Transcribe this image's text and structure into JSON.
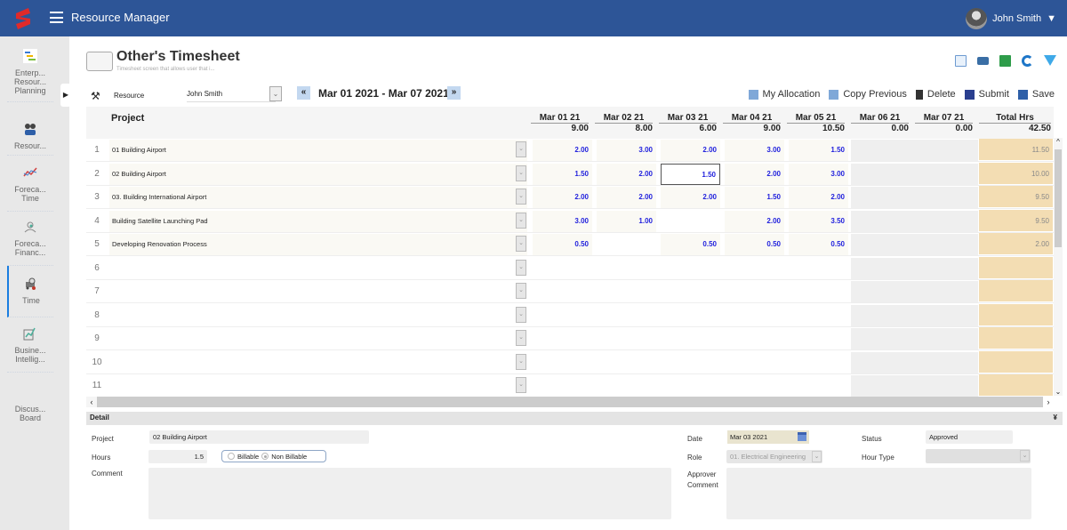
{
  "app": {
    "title": "Resource Manager",
    "user_name": "John Smith"
  },
  "sidebar": {
    "items": [
      {
        "label": "Enterp... Resour... Planning",
        "icon": "gantt-chart-icon"
      },
      {
        "label": "Resour...",
        "icon": "people-icon"
      },
      {
        "label": "Foreca... Time",
        "icon": "line-chart-icon"
      },
      {
        "label": "Foreca... Financ...",
        "icon": "money-plant-icon"
      },
      {
        "label": "Time",
        "icon": "timesheet-truck-icon",
        "active": true
      },
      {
        "label": "Busine... Intellig...",
        "icon": "bi-chart-icon"
      },
      {
        "label": "Discus... Board",
        "icon": "discussion-icon"
      }
    ]
  },
  "page": {
    "title": "Other's Timesheet",
    "subtitle": "Timesheet screen that allows user that i..."
  },
  "toolbar_icons": [
    "preview-icon",
    "print-icon",
    "excel-export-icon",
    "refresh-icon",
    "filter-icon"
  ],
  "resource": {
    "label": "Resource",
    "value": "John Smith"
  },
  "date_range": "Mar 01 2021 - Mar 07 2021",
  "nav": {
    "prev": "«",
    "next": "»"
  },
  "actions": [
    {
      "label": "My Allocation",
      "icon": "allocation-icon"
    },
    {
      "label": "Copy Previous",
      "icon": "copy-icon"
    },
    {
      "label": "Delete",
      "icon": "trash-icon"
    },
    {
      "label": "Submit",
      "icon": "submit-icon"
    },
    {
      "label": "Save",
      "icon": "save-icon"
    }
  ],
  "grid": {
    "project_header": "Project",
    "columns": [
      {
        "date": "Mar 01 21",
        "total": "9.00"
      },
      {
        "date": "Mar 02 21",
        "total": "8.00"
      },
      {
        "date": "Mar 03 21",
        "total": "6.00"
      },
      {
        "date": "Mar 04 21",
        "total": "9.00"
      },
      {
        "date": "Mar 05 21",
        "total": "10.50"
      },
      {
        "date": "Mar 06 21",
        "total": "0.00"
      },
      {
        "date": "Mar 07 21",
        "total": "0.00"
      }
    ],
    "total_header": {
      "label": "Total Hrs",
      "total": "42.50"
    },
    "rows": [
      {
        "num": "1",
        "project": "01 Building Airport",
        "hours": [
          "2.00",
          "3.00",
          "2.00",
          "3.00",
          "1.50",
          "",
          ""
        ],
        "total": "11.50"
      },
      {
        "num": "2",
        "project": "02 Building Airport",
        "hours": [
          "1.50",
          "2.00",
          "1.50",
          "2.00",
          "3.00",
          "",
          ""
        ],
        "total": "10.00",
        "selected_col": 2
      },
      {
        "num": "3",
        "project": "03. Building International Airport",
        "hours": [
          "2.00",
          "2.00",
          "2.00",
          "1.50",
          "2.00",
          "",
          ""
        ],
        "total": "9.50"
      },
      {
        "num": "4",
        "project": "Building Satellite Launching Pad",
        "hours": [
          "3.00",
          "1.00",
          "",
          "2.00",
          "3.50",
          "",
          ""
        ],
        "total": "9.50"
      },
      {
        "num": "5",
        "project": "Developing Renovation Process",
        "hours": [
          "0.50",
          "",
          "0.50",
          "0.50",
          "0.50",
          "",
          ""
        ],
        "total": "2.00"
      },
      {
        "num": "6",
        "project": "",
        "hours": [
          "",
          "",
          "",
          "",
          "",
          "",
          ""
        ],
        "total": ""
      },
      {
        "num": "7",
        "project": "",
        "hours": [
          "",
          "",
          "",
          "",
          "",
          "",
          ""
        ],
        "total": ""
      },
      {
        "num": "8",
        "project": "",
        "hours": [
          "",
          "",
          "",
          "",
          "",
          "",
          ""
        ],
        "total": ""
      },
      {
        "num": "9",
        "project": "",
        "hours": [
          "",
          "",
          "",
          "",
          "",
          "",
          ""
        ],
        "total": ""
      },
      {
        "num": "10",
        "project": "",
        "hours": [
          "",
          "",
          "",
          "",
          "",
          "",
          ""
        ],
        "total": ""
      },
      {
        "num": "11",
        "project": "",
        "hours": [
          "",
          "",
          "",
          "",
          "",
          "",
          ""
        ],
        "total": ""
      }
    ]
  },
  "detail": {
    "header": "Detail",
    "project_label": "Project",
    "project_value": "02 Building Airport",
    "hours_label": "Hours",
    "hours_value": "1.5",
    "billable_label": "Billable",
    "non_billable_label": "Non Billable",
    "billing_selected": "Non Billable",
    "comment_label": "Comment",
    "comment_value": "",
    "date_label": "Date",
    "date_value": "Mar 03 2021",
    "role_label": "Role",
    "role_value": "01. Electrical Engineering",
    "approver_comment_label_1": "Approver",
    "approver_comment_label_2": "Comment",
    "approver_comment_value": "",
    "status_label": "Status",
    "status_value": "Approved",
    "hour_type_label": "Hour Type",
    "hour_type_value": ""
  },
  "colors": {
    "brand_bar": "#2d5597",
    "hours_text": "#2222dd",
    "total_col": "#f3ddb3",
    "active_nav": "#1a7de0"
  }
}
